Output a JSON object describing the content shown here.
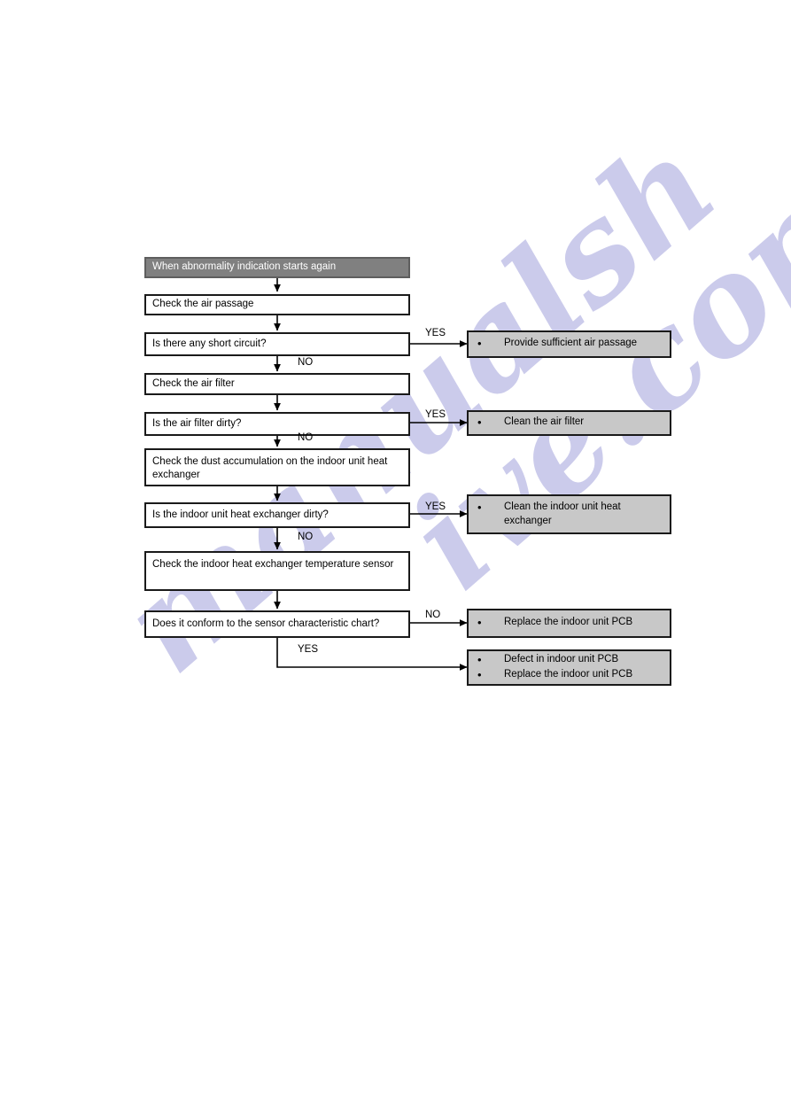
{
  "page": {
    "watermark_left": "manualsh",
    "watermark_right": "ive.com"
  },
  "flowchart": {
    "title": "When abnormality indication starts again",
    "type": "troubleshooting-flowchart",
    "colors": {
      "header_fill": "#808080",
      "header_text": "#ffffff",
      "process_fill": "#ffffff",
      "action_fill": "#c8c8c8",
      "border": "#1a1a1a",
      "watermark": "#c9c9ea"
    },
    "nodes": [
      {
        "id": "start",
        "kind": "header",
        "text": "When abnormality indication starts again"
      },
      {
        "id": "chk1",
        "kind": "process",
        "text": "Check the air passage"
      },
      {
        "id": "dec1",
        "kind": "decision",
        "text": "Is there any short circuit?"
      },
      {
        "id": "chk2",
        "kind": "process",
        "text": "Check the air filter"
      },
      {
        "id": "dec2",
        "kind": "decision",
        "text": "Is the air filter dirty?"
      },
      {
        "id": "chk3",
        "kind": "process",
        "text": "Check the dust accumulation on the indoor unit heat exchanger"
      },
      {
        "id": "dec3",
        "kind": "decision",
        "text": "Is the indoor unit heat exchanger dirty?"
      },
      {
        "id": "chk4",
        "kind": "process",
        "text": "Check the indoor heat exchanger temperature sensor"
      },
      {
        "id": "dec4",
        "kind": "decision",
        "text": "Does it conform to the sensor characteristic chart?"
      }
    ],
    "actions": [
      {
        "id": "act1",
        "items": [
          "Provide sufficient air passage"
        ]
      },
      {
        "id": "act2",
        "items": [
          "Clean the air filter"
        ]
      },
      {
        "id": "act3",
        "items": [
          "Clean the indoor unit heat exchanger"
        ]
      },
      {
        "id": "act4",
        "items": [
          "Replace the indoor unit PCB"
        ]
      },
      {
        "id": "act5",
        "items": [
          "Defect in indoor unit PCB",
          "Replace the indoor unit PCB"
        ]
      }
    ],
    "edge_labels": {
      "dec1_yes": "YES",
      "dec1_no": "NO",
      "dec2_yes": "YES",
      "dec2_no": "NO",
      "dec3_yes": "YES",
      "dec3_no": "NO",
      "dec4_no": "NO",
      "dec4_yes": "YES"
    },
    "bullet_glyph": "•"
  }
}
